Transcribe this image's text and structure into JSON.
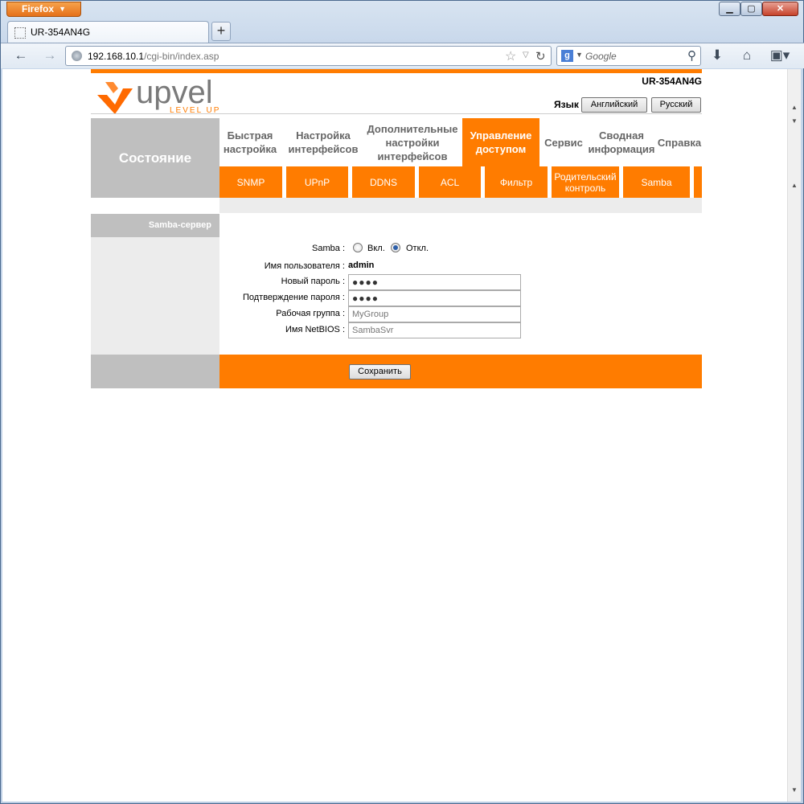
{
  "browser": {
    "app_button": "Firefox",
    "tab_title": "UR-354AN4G",
    "url_host": "192.168.10.1",
    "url_path": "/cgi-bin/index.asp",
    "search_placeholder": "Google"
  },
  "header": {
    "model": "UR-354AN4G",
    "logo_text": "upvel",
    "logo_tagline": "LEVEL UP",
    "lang_label": "Язык",
    "lang_en": "Английский",
    "lang_ru": "Русский"
  },
  "nav": {
    "status": "Состояние",
    "main": [
      {
        "label": "Быстрая настройка"
      },
      {
        "label": "Настройка интерфейсов"
      },
      {
        "label": "Дополнительные настройки интерфейсов"
      },
      {
        "label": "Управление доступом"
      },
      {
        "label": "Сервис"
      },
      {
        "label": "Сводная информация"
      },
      {
        "label": "Справка"
      }
    ],
    "sub": [
      {
        "label": "SNMP"
      },
      {
        "label": "UPnP"
      },
      {
        "label": "DDNS"
      },
      {
        "label": "ACL"
      },
      {
        "label": "Фильтр"
      },
      {
        "label": "Родительский контроль"
      },
      {
        "label": "Samba"
      }
    ]
  },
  "section": {
    "title": "Samba-сервер"
  },
  "form": {
    "samba_label": "Samba :",
    "samba_on": "Вкл.",
    "samba_off": "Откл.",
    "samba_selected": "off",
    "username_label": "Имя пользователя :",
    "username_value": "admin",
    "new_password_label": "Новый пароль :",
    "new_password_value": "●●●●",
    "confirm_password_label": "Подтверждение пароля :",
    "confirm_password_value": "●●●●",
    "workgroup_label": "Рабочая группа :",
    "workgroup_value": "MyGroup",
    "netbios_label": "Имя NetBIOS :",
    "netbios_value": "SambaSvr",
    "save_label": "Сохранить"
  },
  "colors": {
    "accent": "#ff7c00",
    "gray": "#bfbfbf"
  }
}
